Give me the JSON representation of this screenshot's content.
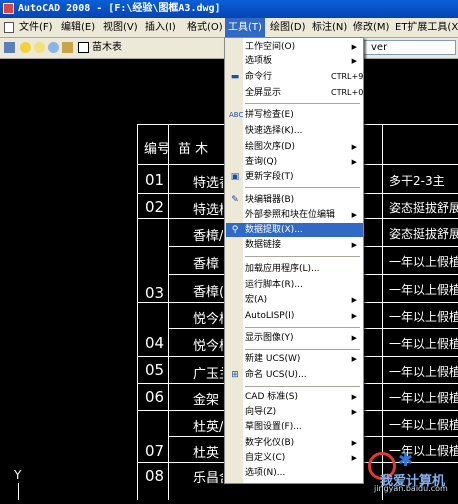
{
  "window": {
    "title": "AutoCAD 2008 - [F:\\经验\\图框A3.dwg]"
  },
  "menubar": {
    "items": [
      {
        "label": "文件(F)"
      },
      {
        "label": "编辑(E)"
      },
      {
        "label": "视图(V)"
      },
      {
        "label": "插入(I)"
      },
      {
        "label": "格式(O)"
      },
      {
        "label": "工具(T)",
        "active": true
      },
      {
        "label": "绘图(D)"
      },
      {
        "label": "标注(N)"
      },
      {
        "label": "修改(M)"
      },
      {
        "label": "ET扩展工具(X)"
      }
    ]
  },
  "toolbar": {
    "layer_name": "苗木表",
    "combo_value": "ver"
  },
  "tools_menu": {
    "items": [
      {
        "label": "工作空间(O)",
        "submenu": true
      },
      {
        "label": "选项板",
        "submenu": true
      },
      {
        "label": "命令行",
        "shortcut": "CTRL+9",
        "icon": "command-line-icon"
      },
      {
        "label": "全屏显示",
        "shortcut": "CTRL+0"
      },
      {
        "sep": true
      },
      {
        "label": "拼写检查(E)",
        "icon": "spellcheck-icon"
      },
      {
        "label": "快速选择(K)..."
      },
      {
        "label": "绘图次序(D)",
        "submenu": true
      },
      {
        "label": "查询(Q)",
        "submenu": true
      },
      {
        "label": "更新字段(T)",
        "icon": "update-field-icon"
      },
      {
        "sep": true
      },
      {
        "label": "块编辑器(B)",
        "icon": "block-editor-icon"
      },
      {
        "label": "外部参照和块在位编辑",
        "submenu": true
      },
      {
        "label": "数据提取(X)...",
        "highlight": true,
        "icon": "data-extraction-icon"
      },
      {
        "label": "数据链接",
        "submenu": true
      },
      {
        "sep": true
      },
      {
        "label": "加载应用程序(L)..."
      },
      {
        "label": "运行脚本(R)..."
      },
      {
        "label": "宏(A)",
        "submenu": true
      },
      {
        "label": "AutoLISP(I)",
        "submenu": true
      },
      {
        "sep": true
      },
      {
        "label": "显示图像(Y)",
        "submenu": true
      },
      {
        "sep": true
      },
      {
        "label": "新建 UCS(W)",
        "submenu": true
      },
      {
        "label": "命名 UCS(U)...",
        "icon": "named-ucs-icon"
      },
      {
        "sep": true
      },
      {
        "label": "CAD 标准(S)",
        "submenu": true
      },
      {
        "label": "向导(Z)",
        "submenu": true
      },
      {
        "label": "草图设置(F)..."
      },
      {
        "label": "数字化仪(B)",
        "submenu": true
      },
      {
        "label": "自定义(C)",
        "submenu": true
      },
      {
        "label": "选项(N)..."
      }
    ]
  },
  "drawing": {
    "header": {
      "num": "编号",
      "name": "苗 木"
    },
    "rows": [
      {
        "num": "01",
        "plant": "特选香",
        "note": "多干2-3主"
      },
      {
        "num": "02",
        "plant": "特选桃",
        "note": "姿态挺拔舒展"
      },
      {
        "num": "",
        "plant": "香樟/",
        "note": "姿态挺拔舒展"
      },
      {
        "num": "",
        "plant": "香樟",
        "note": "一年以上假植"
      },
      {
        "num": "03",
        "plant": "香樟(",
        "note": "一年以上假植"
      },
      {
        "num": "",
        "plant": "",
        "note": "一年以上假植"
      },
      {
        "num": "",
        "plant": "悦今桂",
        "note": "一年以上假植"
      },
      {
        "num": "04",
        "plant": "悦今桂",
        "note": "一年以上假植"
      },
      {
        "num": "05",
        "plant": "广玉兰",
        "note": "一年以上假植"
      },
      {
        "num": "06",
        "plant": "金架",
        "note": "一年以上假植"
      },
      {
        "num": "",
        "plant": "杜英/",
        "note": "一年以上假植"
      },
      {
        "num": "07",
        "plant": "杜英",
        "note": "一年以上假植"
      },
      {
        "num": "08",
        "plant": "乐昌含",
        "note": "一年以上假植"
      }
    ],
    "axis_label": "Y"
  },
  "watermark": {
    "text": "我爱计算机",
    "url": "jingyan.baidu.com"
  }
}
